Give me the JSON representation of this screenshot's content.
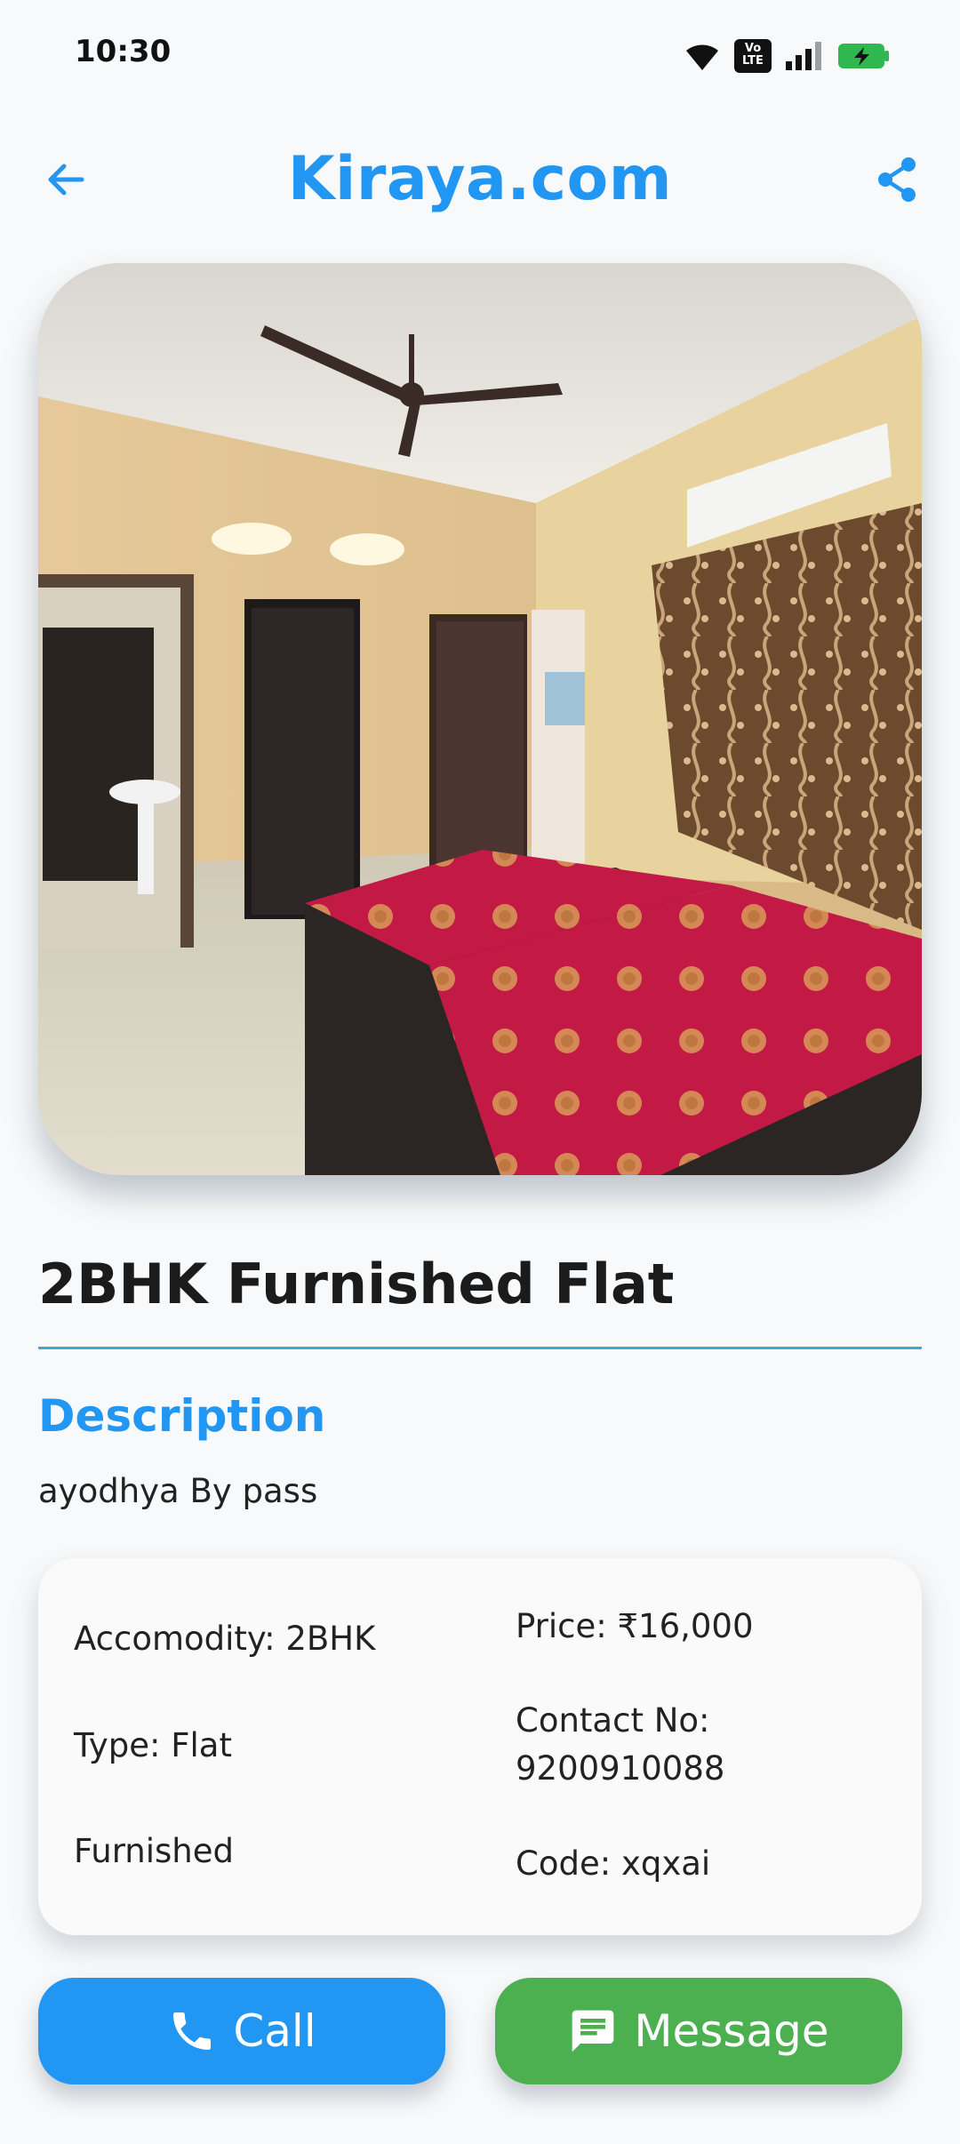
{
  "status": {
    "time": "10:30",
    "volte": "Vo\nLTE"
  },
  "header": {
    "title": "Kiraya.com",
    "back_icon": "arrow-left-icon",
    "share_icon": "share-icon"
  },
  "listing": {
    "title": "2BHK Furnished Flat",
    "description_heading": "Description",
    "description": "ayodhya By pass",
    "details": {
      "accomodity": "Accomodity: 2BHK",
      "type": "Type: Flat",
      "furnished": "Furnished",
      "price": "Price: ₹16,000",
      "contact_label": "Contact No:",
      "contact_number": "9200910088",
      "code": "Code: xqxai"
    }
  },
  "actions": {
    "call_label": "Call",
    "message_label": "Message",
    "call_color": "#2196f3",
    "message_color": "#4caf50"
  },
  "colors": {
    "accent": "#2196f3",
    "divider": "#42a5d8"
  }
}
